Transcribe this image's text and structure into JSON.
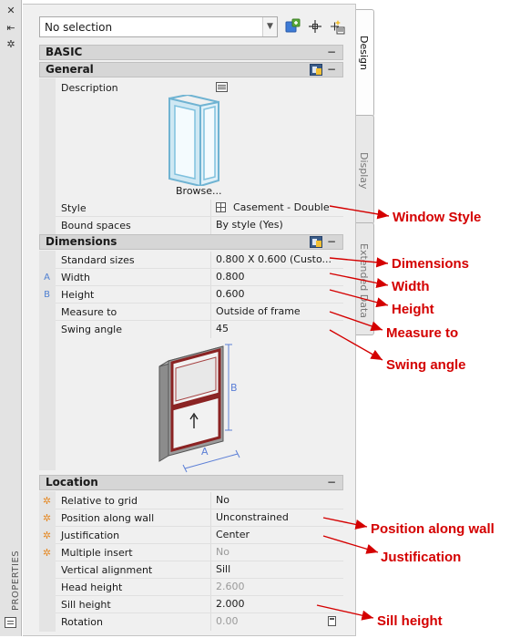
{
  "strip": {
    "close_icon": "close-icon",
    "autohide_icon": "autohide-icon",
    "settings_icon": "settings-icon",
    "title": "PROPERTIES"
  },
  "toolbar": {
    "selection_value": "No selection"
  },
  "tabs": {
    "design": "Design",
    "display": "Display",
    "extended": "Extended Data"
  },
  "categories": {
    "basic": "BASIC",
    "general": "General",
    "dimensions": "Dimensions",
    "location": "Location"
  },
  "general": {
    "description_label": "Description",
    "browse_label": "Browse...",
    "style_label": "Style",
    "style_value": "Casement - Double",
    "bound_label": "Bound spaces",
    "bound_value": "By style (Yes)"
  },
  "dimensions": {
    "standard_label": "Standard sizes",
    "standard_value": "0.800  X  0.600 (Custo...",
    "width_marker": "A",
    "width_label": "Width",
    "width_value": "0.800",
    "height_marker": "B",
    "height_label": "Height",
    "height_value": "0.600",
    "measure_label": "Measure to",
    "measure_value": "Outside of frame",
    "swing_label": "Swing angle",
    "swing_value": "45",
    "diagram_a": "A",
    "diagram_b": "B"
  },
  "location": {
    "relgrid_label": "Relative to grid",
    "relgrid_value": "No",
    "position_label": "Position along wall",
    "position_value": "Unconstrained",
    "just_label": "Justification",
    "just_value": "Center",
    "multi_label": "Multiple insert",
    "multi_value": "No",
    "valign_label": "Vertical alignment",
    "valign_value": "Sill",
    "head_label": "Head height",
    "head_value": "2.600",
    "sill_label": "Sill height",
    "sill_value": "2.000",
    "rotation_label": "Rotation",
    "rotation_value": "0.00"
  },
  "annotations": {
    "window_style": "Window Style",
    "dimensions": "Dimensions",
    "width": "Width",
    "height": "Height",
    "measure_to": "Measure to",
    "swing_angle": "Swing angle",
    "position_along_wall": "Position along wall",
    "justification": "Justification",
    "sill_height": "Sill height"
  },
  "colors": {
    "annotation": "#d40000",
    "marker_letter": "#4f7fd1",
    "marker_star": "#e58a27",
    "frame_red": "#8b2323"
  }
}
